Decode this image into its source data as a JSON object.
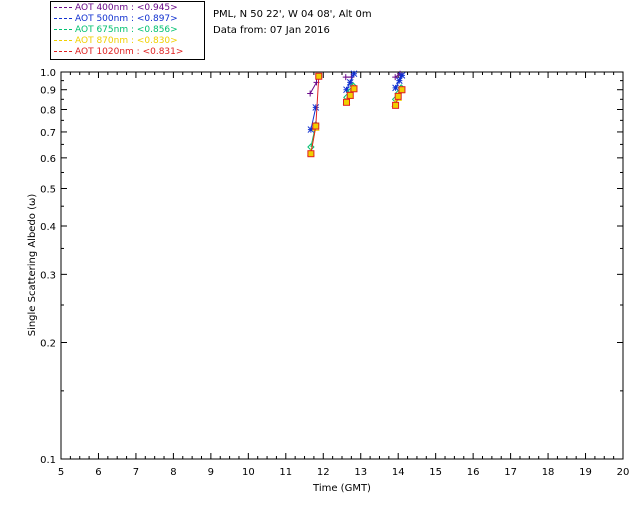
{
  "header": {
    "site_line": "PML, N 50 22', W 04 08', Alt 0m",
    "date_line": "Data from: 07 Jan 2016"
  },
  "chart_data": {
    "type": "scatter",
    "title": "",
    "xlabel": "Time (GMT)",
    "ylabel": "Single Scattering Albedo (ω)",
    "xlim": [
      5,
      20
    ],
    "ylim": [
      0.1,
      1.0
    ],
    "yscale": "log",
    "grid": false,
    "legend_position": "top-left",
    "xticks": [
      "5",
      "6",
      "7",
      "8",
      "9",
      "10",
      "11",
      "12",
      "13",
      "14",
      "15",
      "16",
      "17",
      "18",
      "19",
      "20"
    ],
    "yticks": [
      {
        "value": 1.0,
        "label": "1.0"
      },
      {
        "value": 0.9,
        "label": "0.9"
      },
      {
        "value": 0.8,
        "label": "0.8"
      },
      {
        "value": 0.7,
        "label": "0.7"
      },
      {
        "value": 0.6,
        "label": "0.6"
      },
      {
        "value": 0.5,
        "label": "0.5"
      },
      {
        "value": 0.4,
        "label": "0.4"
      },
      {
        "value": 0.3,
        "label": "0.3"
      },
      {
        "value": 0.2,
        "label": "0.2"
      },
      {
        "value": 0.1,
        "label": "0.1"
      }
    ],
    "series": [
      {
        "name": "AOT  400nm : <0.945>",
        "color": "#6a0a8a",
        "marker": "plus",
        "segments": [
          [
            {
              "x": 11.65,
              "y": 0.88
            },
            {
              "x": 11.82,
              "y": 0.94
            }
          ],
          [
            {
              "x": 12.6,
              "y": 0.97
            },
            {
              "x": 12.75,
              "y": 0.97
            }
          ],
          [
            {
              "x": 13.92,
              "y": 0.97
            },
            {
              "x": 14.05,
              "y": 0.99
            }
          ]
        ]
      },
      {
        "name": "AOT  500nm : <0.897>",
        "color": "#1030d0",
        "marker": "asterisk",
        "segments": [
          [
            {
              "x": 11.67,
              "y": 0.71
            },
            {
              "x": 11.8,
              "y": 0.81
            }
          ],
          [
            {
              "x": 12.62,
              "y": 0.9
            },
            {
              "x": 12.72,
              "y": 0.94
            },
            {
              "x": 12.82,
              "y": 0.99
            }
          ],
          [
            {
              "x": 13.93,
              "y": 0.91
            },
            {
              "x": 14.03,
              "y": 0.95
            },
            {
              "x": 14.1,
              "y": 0.98
            }
          ]
        ]
      },
      {
        "name": "AOT  675nm : <0.856>",
        "color": "#00c070",
        "marker": "diamond",
        "segments": [
          [
            {
              "x": 11.67,
              "y": 0.64
            },
            {
              "x": 11.8,
              "y": 0.73
            }
          ],
          [
            {
              "x": 12.63,
              "y": 0.86
            },
            {
              "x": 12.72,
              "y": 0.89
            },
            {
              "x": 12.8,
              "y": 0.92
            }
          ],
          [
            {
              "x": 13.93,
              "y": 0.85
            },
            {
              "x": 14.0,
              "y": 0.88
            },
            {
              "x": 14.08,
              "y": 0.91
            }
          ]
        ]
      },
      {
        "name": "AOT  870nm : <0.830>",
        "color": "#f0d000",
        "marker": "triangle",
        "segments": [
          [
            {
              "x": 11.67,
              "y": 0.62
            },
            {
              "x": 11.8,
              "y": 0.72
            }
          ],
          [
            {
              "x": 12.62,
              "y": 0.84
            },
            {
              "x": 12.72,
              "y": 0.87
            },
            {
              "x": 12.8,
              "y": 0.91
            }
          ],
          [
            {
              "x": 13.92,
              "y": 0.83
            },
            {
              "x": 14.0,
              "y": 0.86
            },
            {
              "x": 14.08,
              "y": 0.9
            }
          ]
        ]
      },
      {
        "name": "AOT 1020nm : <0.831>",
        "color": "#e02020",
        "marker": "square",
        "segments": [
          [
            {
              "x": 11.67,
              "y": 0.615
            },
            {
              "x": 11.8,
              "y": 0.725
            },
            {
              "x": 11.88,
              "y": 0.975
            }
          ],
          [
            {
              "x": 12.62,
              "y": 0.835
            },
            {
              "x": 12.72,
              "y": 0.87
            },
            {
              "x": 12.82,
              "y": 0.905
            }
          ],
          [
            {
              "x": 13.93,
              "y": 0.82
            },
            {
              "x": 14.0,
              "y": 0.865
            },
            {
              "x": 14.1,
              "y": 0.9
            }
          ]
        ]
      }
    ]
  },
  "colors": {
    "background": "#ffffff",
    "axes": "#000000",
    "marker_fill": "#f0d000"
  }
}
